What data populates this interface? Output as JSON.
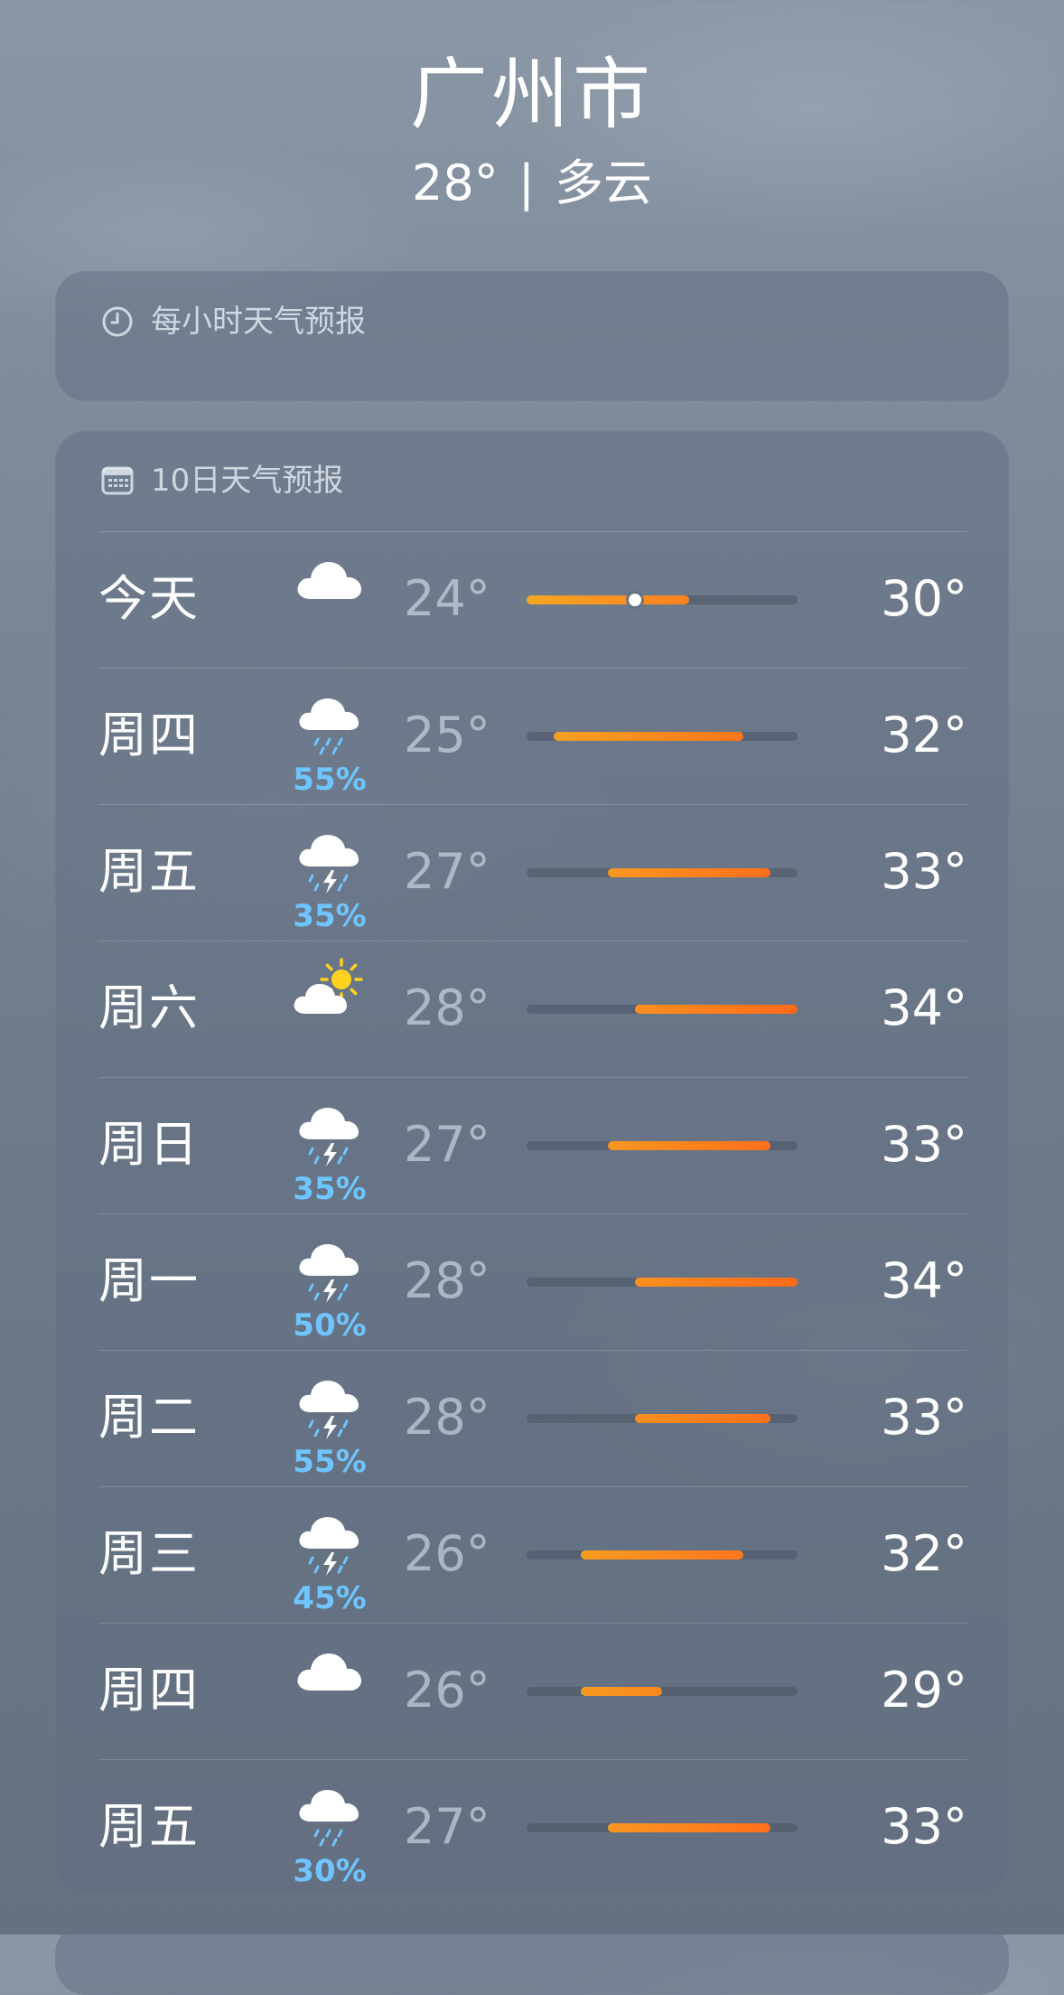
{
  "header": {
    "city": "广州市",
    "temp": "28°",
    "separator": "|",
    "condition": "多云"
  },
  "hourly": {
    "icon": "clock-icon",
    "title": "每小时天气预报"
  },
  "daily": {
    "icon": "calendar-icon",
    "title": "10日天气预报",
    "range_min": 24,
    "range_max": 34,
    "current_temp": 28,
    "days": [
      {
        "day": "今天",
        "icon": "cloud-icon",
        "precip": "",
        "low": "24°",
        "high": "30°",
        "low_val": 24,
        "high_val": 30,
        "is_today": true
      },
      {
        "day": "周四",
        "icon": "cloud-rain-icon",
        "precip": "55%",
        "low": "25°",
        "high": "32°",
        "low_val": 25,
        "high_val": 32,
        "is_today": false
      },
      {
        "day": "周五",
        "icon": "cloud-bolt-rain-icon",
        "precip": "35%",
        "low": "27°",
        "high": "33°",
        "low_val": 27,
        "high_val": 33,
        "is_today": false
      },
      {
        "day": "周六",
        "icon": "cloud-sun-icon",
        "precip": "",
        "low": "28°",
        "high": "34°",
        "low_val": 28,
        "high_val": 34,
        "is_today": false
      },
      {
        "day": "周日",
        "icon": "cloud-bolt-rain-icon",
        "precip": "35%",
        "low": "27°",
        "high": "33°",
        "low_val": 27,
        "high_val": 33,
        "is_today": false
      },
      {
        "day": "周一",
        "icon": "cloud-bolt-rain-icon",
        "precip": "50%",
        "low": "28°",
        "high": "34°",
        "low_val": 28,
        "high_val": 34,
        "is_today": false
      },
      {
        "day": "周二",
        "icon": "cloud-bolt-rain-icon",
        "precip": "55%",
        "low": "28°",
        "high": "33°",
        "low_val": 28,
        "high_val": 33,
        "is_today": false
      },
      {
        "day": "周三",
        "icon": "cloud-bolt-rain-icon",
        "precip": "45%",
        "low": "26°",
        "high": "32°",
        "low_val": 26,
        "high_val": 32,
        "is_today": false
      },
      {
        "day": "周四",
        "icon": "cloud-icon",
        "precip": "",
        "low": "26°",
        "high": "29°",
        "low_val": 26,
        "high_val": 29,
        "is_today": false
      },
      {
        "day": "周五",
        "icon": "cloud-rain-icon",
        "precip": "30%",
        "low": "27°",
        "high": "33°",
        "low_val": 27,
        "high_val": 33,
        "is_today": false
      }
    ]
  },
  "colors": {
    "precip_text": "#6ec5ff",
    "bar_cool": "#f5a623",
    "bar_warm": "#ff6a1a"
  }
}
